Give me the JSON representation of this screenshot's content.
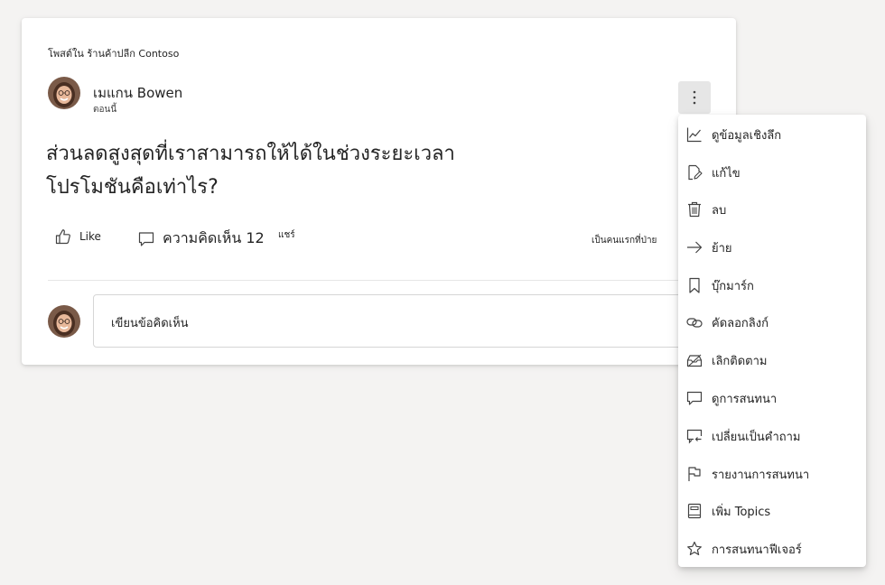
{
  "post": {
    "posted_in": "โพสต์ใน ร้านค้าปลีก Contoso",
    "author_name": "เมแกน Bowen",
    "time": "ตอนนี้",
    "title": "ส่วนลดสูงสุดที่เราสามารถให้ได้ในช่วงระยะเวลาโปรโมชันคือเท่าไร?"
  },
  "actions": {
    "like_label": "Like",
    "comment_label": "ความคิดเห็น 12",
    "share_label": "แชร์",
    "first_vote": "เป็นคนแรกที่ป่าย"
  },
  "comment_box": {
    "placeholder": "เขียนข้อคิดเห็น"
  },
  "menu": {
    "items": [
      {
        "label": "ดูข้อมูลเชิงลึก",
        "icon": "insights-icon"
      },
      {
        "label": "แก้ไข",
        "icon": "edit-icon"
      },
      {
        "label": "ลบ",
        "icon": "delete-icon"
      },
      {
        "label": "ย้าย",
        "icon": "move-arrow-icon"
      },
      {
        "label": "บุ๊กมาร์ก",
        "icon": "bookmark-icon"
      },
      {
        "label": "คัดลอกลิงก์",
        "icon": "link-icon"
      },
      {
        "label": "เลิกติดตาม",
        "icon": "unfollow-inbox-icon"
      },
      {
        "label": "ดูการสนทนา",
        "icon": "conversation-icon"
      },
      {
        "label": "เปลี่ยนเป็นคำถาม",
        "icon": "change-to-question-icon"
      },
      {
        "label": "รายงานการสนทนา",
        "icon": "flag-icon"
      },
      {
        "label": "เพิ่ม Topics",
        "icon": "topics-book-icon"
      },
      {
        "label": "การสนทนาฟีเจอร์",
        "icon": "star-icon"
      }
    ]
  },
  "colors": {
    "background": "#f4f3f2",
    "card": "#ffffff",
    "text": "#242424",
    "more_button_bg": "#e6e6e6"
  }
}
